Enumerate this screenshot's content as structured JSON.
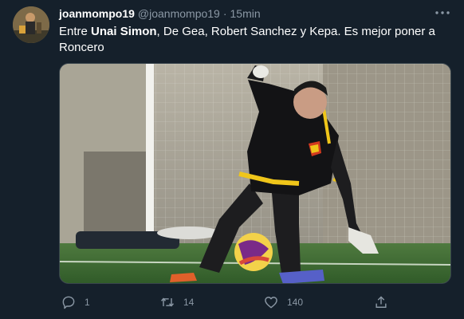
{
  "tweet": {
    "display_name": "joanmompo19",
    "handle": "@joanmompo19",
    "separator": "·",
    "timestamp": "15min",
    "more_label": "···",
    "text_before": "Entre ",
    "text_bold": "Unai Simon",
    "text_after": ", De Gea, Robert Sanchez y Kepa. Es mejor poner a Roncero",
    "replies": "1",
    "retweets": "14",
    "likes": "140"
  },
  "colors": {
    "background": "#15202b",
    "secondary_text": "#8b98a5",
    "border": "#38444d"
  },
  "icons": {
    "reply": "speech-bubble-icon",
    "retweet": "retweet-arrows-icon",
    "like": "heart-icon",
    "share": "share-upload-icon",
    "more": "ellipsis-icon"
  }
}
